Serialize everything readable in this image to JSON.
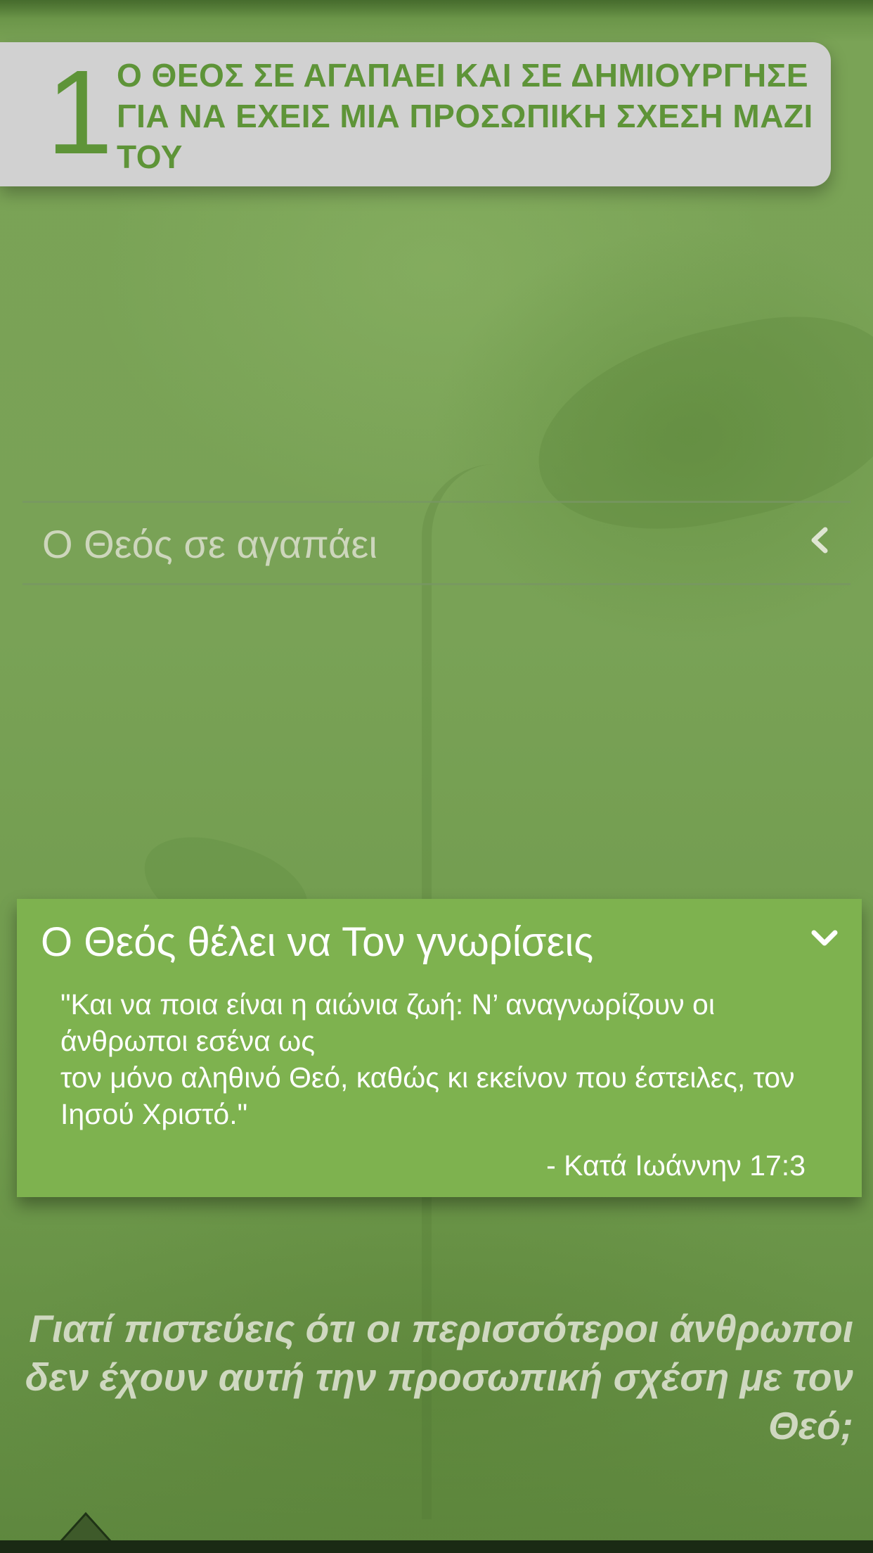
{
  "header": {
    "number": "1",
    "title": "Ο ΘΕΟΣ ΣΕ ΑΓΑΠΑΕΙ ΚΑΙ ΣΕ ΔΗΜΙΟΥΡΓΗΣΕ ΓΙΑ ΝΑ ΕΧΕΙΣ ΜΙΑ ΠΡΟΣΩΠΙΚΗ ΣΧΕΣΗ ΜΑΖΙ ΤΟΥ"
  },
  "accordion": [
    {
      "label": "Ο Θεός σε αγαπάει",
      "state": "collapsed",
      "icon": "chevron-left-icon"
    },
    {
      "label": "Ο Θεός θέλει να Τον γνωρίσεις",
      "state": "expanded",
      "icon": "chevron-down-icon",
      "quote_lines": [
        "\"Και να ποια είναι η αιώνια ζωή: Ν’ αναγνωρίζουν οι άνθρωποι εσένα ως",
        "τον μόνο αληθινό Θεό, καθώς κι εκείνον που έστειλες, τον Ιησού Χριστό.\""
      ],
      "reference": "- Κατά Ιωάννην 17:3"
    }
  ],
  "question": {
    "lines": [
      "Γιατί πιστεύεις ότι οι περισσότεροι άνθρωποι",
      "δεν έχουν αυτή την προσωπική σχέση με τον Θεό;"
    ]
  },
  "footer": {
    "icon": "up-arrow-icon"
  },
  "colors": {
    "brand_green": "#5e9438",
    "panel_green": "#7eb24f",
    "header_gray": "#d1d1d1"
  }
}
